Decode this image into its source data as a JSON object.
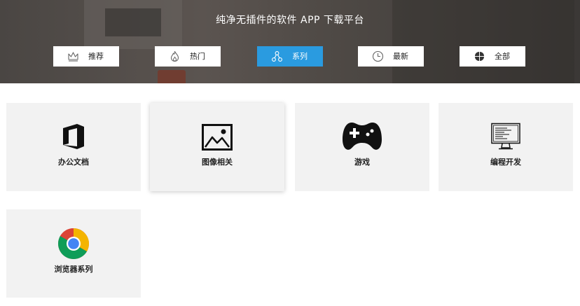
{
  "hero": {
    "title": "纯净无插件的软件 APP 下载平台"
  },
  "tabs": [
    {
      "label": "推荐",
      "icon": "crown-icon",
      "active": false
    },
    {
      "label": "热门",
      "icon": "flame-icon",
      "active": false
    },
    {
      "label": "系列",
      "icon": "nodes-icon",
      "active": true
    },
    {
      "label": "最新",
      "icon": "clock-icon",
      "active": false
    },
    {
      "label": "全部",
      "icon": "grid-icon",
      "active": false
    }
  ],
  "categories": [
    {
      "label": "办公文档",
      "icon": "office-icon"
    },
    {
      "label": "图像相关",
      "icon": "image-icon"
    },
    {
      "label": "游戏",
      "icon": "gamepad-icon"
    },
    {
      "label": "编程开发",
      "icon": "monitor-code-icon"
    },
    {
      "label": "浏览器系列",
      "icon": "chrome-icon"
    }
  ],
  "colors": {
    "accent": "#2a9be0",
    "card_bg": "#f2f2f2",
    "hero_bg": "#4a4643"
  }
}
